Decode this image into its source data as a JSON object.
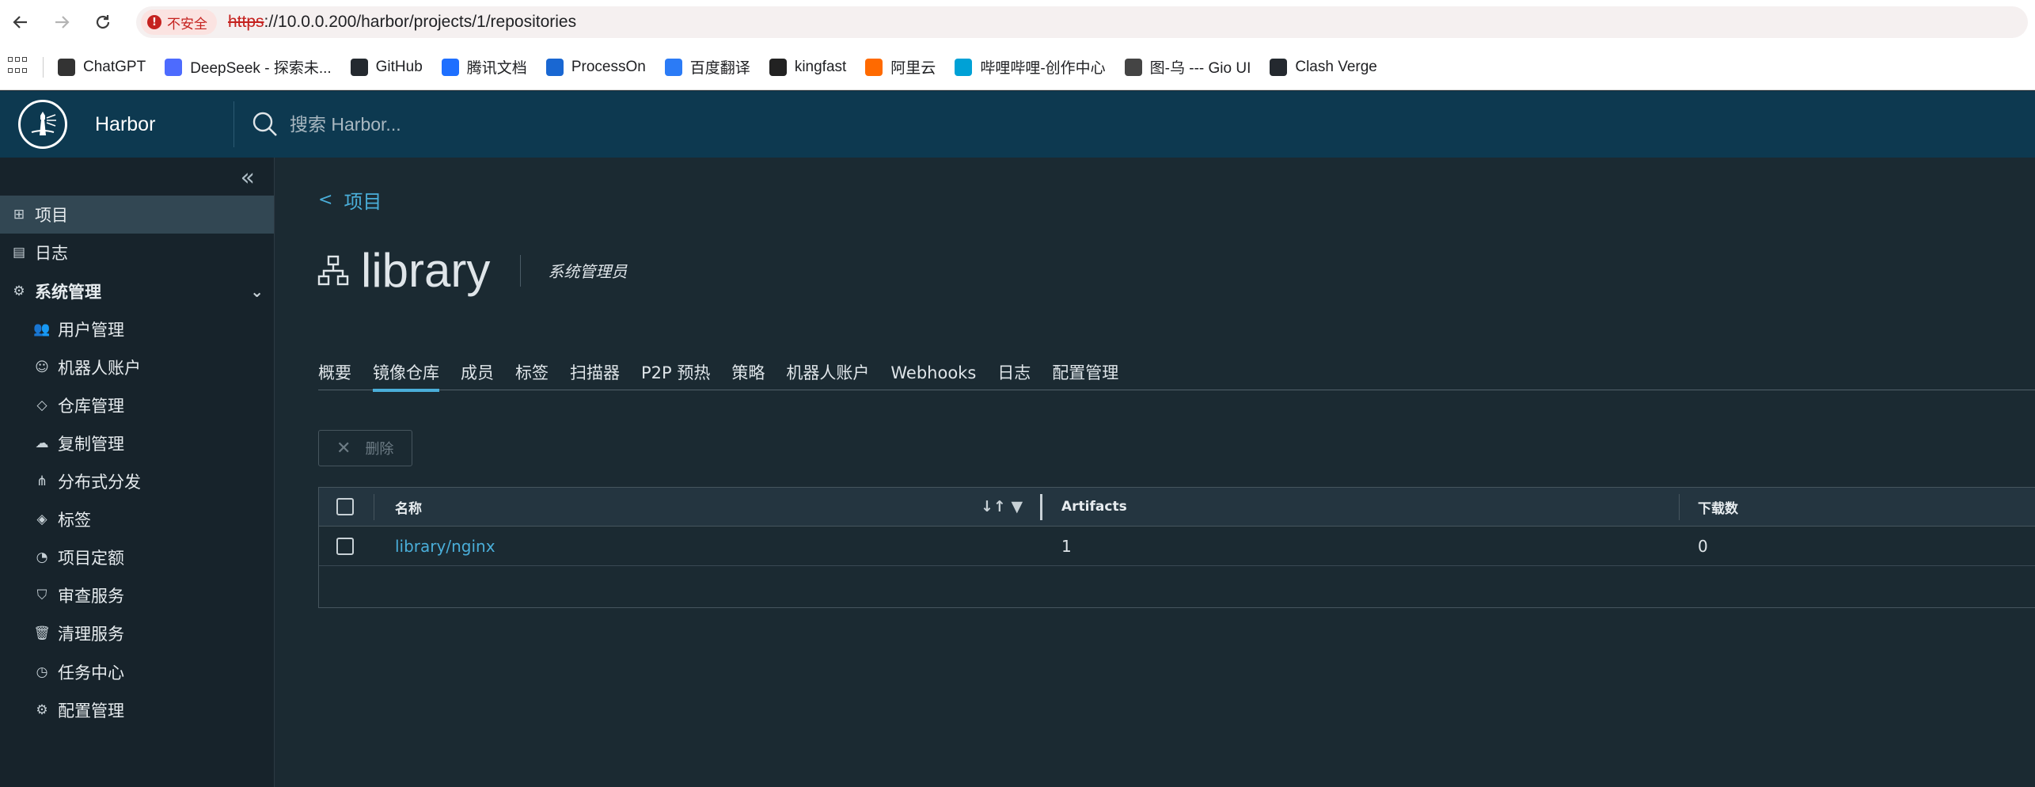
{
  "browser": {
    "security_label": "不安全",
    "url_scheme": "https",
    "url_rest": "://10.0.0.200/harbor/projects/1/repositories",
    "bookmarks": [
      {
        "label": "ChatGPT",
        "icon": "chatgpt-icon",
        "color": "#333333"
      },
      {
        "label": "DeepSeek - 探索未...",
        "icon": "deepseek-icon",
        "color": "#4d6bfe"
      },
      {
        "label": "GitHub",
        "icon": "github-icon",
        "color": "#24292f"
      },
      {
        "label": "腾讯文档",
        "icon": "tencent-docs-icon",
        "color": "#1e6fff"
      },
      {
        "label": "ProcessOn",
        "icon": "processon-icon",
        "color": "#1967d2"
      },
      {
        "label": "百度翻译",
        "icon": "baidu-translate-icon",
        "color": "#2b7bf6"
      },
      {
        "label": "kingfast",
        "icon": "cursor-icon",
        "color": "#222222"
      },
      {
        "label": "阿里云",
        "icon": "aliyun-icon",
        "color": "#ff6a00"
      },
      {
        "label": "哔哩哔哩-创作中心",
        "icon": "bilibili-icon",
        "color": "#00a1d6"
      },
      {
        "label": "图-乌 --- Gio UI",
        "icon": "gio-icon",
        "color": "#444444"
      },
      {
        "label": "Clash Verge",
        "icon": "github-icon",
        "color": "#24292f"
      }
    ]
  },
  "header": {
    "brand": "Harbor",
    "search_placeholder": "搜索 Harbor..."
  },
  "sidebar": {
    "items": [
      {
        "label": "项目",
        "icon": "projects-icon",
        "active": true
      },
      {
        "label": "日志",
        "icon": "logs-icon"
      },
      {
        "label": "系统管理",
        "icon": "admin-icon",
        "group": true
      },
      {
        "label": "用户管理",
        "icon": "users-icon"
      },
      {
        "label": "机器人账户",
        "icon": "robot-icon"
      },
      {
        "label": "仓库管理",
        "icon": "registry-icon"
      },
      {
        "label": "复制管理",
        "icon": "replication-icon"
      },
      {
        "label": "分布式分发",
        "icon": "share-icon"
      },
      {
        "label": "标签",
        "icon": "tag-icon"
      },
      {
        "label": "项目定额",
        "icon": "quota-icon"
      },
      {
        "label": "审查服务",
        "icon": "shield-icon"
      },
      {
        "label": "清理服务",
        "icon": "trash-icon"
      },
      {
        "label": "任务中心",
        "icon": "dashboard-icon"
      },
      {
        "label": "配置管理",
        "icon": "gear-icon"
      }
    ]
  },
  "main": {
    "breadcrumb": "项目",
    "title": "library",
    "role": "系统管理员",
    "tabs": [
      "概要",
      "镜像仓库",
      "成员",
      "标签",
      "扫描器",
      "P2P 预热",
      "策略",
      "机器人账户",
      "Webhooks",
      "日志",
      "配置管理"
    ],
    "active_tab": 1,
    "delete_label": "删除",
    "columns": {
      "name": "名称",
      "artifacts": "Artifacts",
      "pulls": "下载数"
    },
    "rows": [
      {
        "name": "library/nginx",
        "artifacts": "1",
        "pulls": "0"
      }
    ]
  },
  "colors": {
    "header_bg": "#0d3950",
    "accent": "#4aaed9",
    "sidebar_bg": "#17232b",
    "main_bg": "#1b2a32"
  }
}
